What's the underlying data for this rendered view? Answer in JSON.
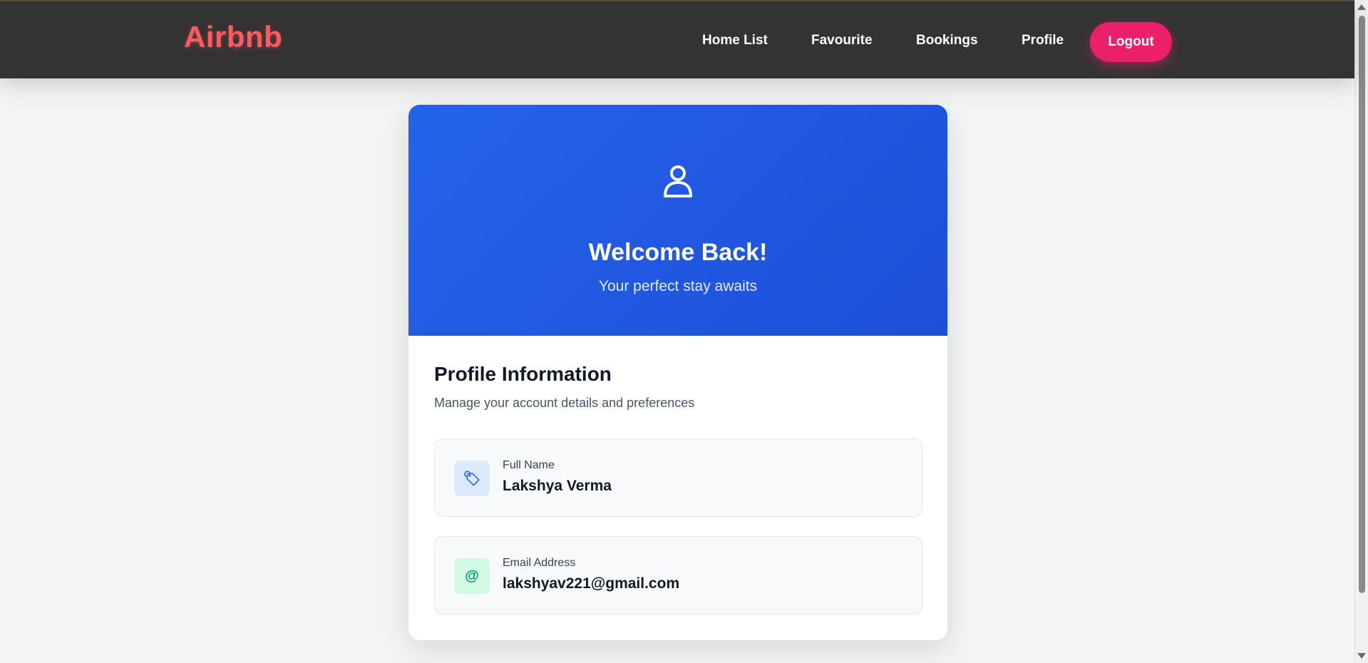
{
  "navbar": {
    "brand": "Airbnb",
    "links": [
      "Home List",
      "Favourite",
      "Bookings",
      "Profile"
    ],
    "logout_label": "Logout"
  },
  "hero": {
    "icon": "user-icon",
    "title": "Welcome Back!",
    "subtitle": "Your perfect stay awaits"
  },
  "profile": {
    "title": "Profile Information",
    "subtitle": "Manage your account details and preferences",
    "fields": [
      {
        "icon": "name-tag-icon",
        "glyph": "🏷",
        "label": "Full Name",
        "value": "Lakshya Verma",
        "icon_bg": "#dbeafe",
        "icon_color": "#2563eb"
      },
      {
        "icon": "at-icon",
        "glyph": "@",
        "label": "Email Address",
        "value": "lakshyav221@gmail.com",
        "icon_bg": "#d1fae5",
        "icon_color": "#059669"
      }
    ]
  },
  "colors": {
    "brand": "#ff5a5f",
    "navbar_bg": "#333333",
    "logout": "#ec1f6a",
    "hero": "#2563eb"
  }
}
